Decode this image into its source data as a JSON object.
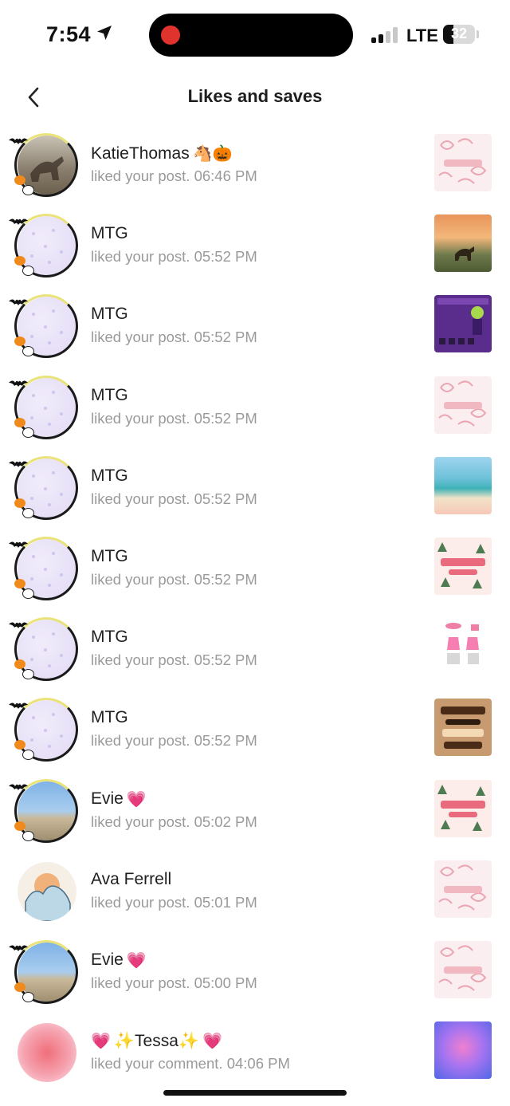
{
  "status_bar": {
    "time": "7:54",
    "network": "LTE",
    "battery": "32",
    "battery_level": 0.32
  },
  "header": {
    "title": "Likes and saves"
  },
  "icons": {
    "back": "chevron-left-icon",
    "location": "location-arrow-icon",
    "signal": "cellular-signal-icon"
  },
  "notifications": [
    {
      "name": "KatieThomas",
      "emoji": "🐴🎃",
      "action": "liked your post.",
      "time": "06:46 PM",
      "avatar": "photo-horse",
      "thumb": "bows"
    },
    {
      "name": "MTG",
      "emoji": "",
      "action": "liked your post.",
      "time": "05:52 PM",
      "avatar": "lavender",
      "thumb": "sunset-horse"
    },
    {
      "name": "MTG",
      "emoji": "",
      "action": "liked your post.",
      "time": "05:52 PM",
      "avatar": "lavender",
      "thumb": "jovial-joker"
    },
    {
      "name": "MTG",
      "emoji": "",
      "action": "liked your post.",
      "time": "05:52 PM",
      "avatar": "lavender",
      "thumb": "bows"
    },
    {
      "name": "MTG",
      "emoji": "",
      "action": "liked your post.",
      "time": "05:52 PM",
      "avatar": "lavender",
      "thumb": "beach"
    },
    {
      "name": "MTG",
      "emoji": "",
      "action": "liked your post.",
      "time": "05:52 PM",
      "avatar": "lavender",
      "thumb": "christmas"
    },
    {
      "name": "MTG",
      "emoji": "",
      "action": "liked your post.",
      "time": "05:52 PM",
      "avatar": "lavender",
      "thumb": "pink-outfit"
    },
    {
      "name": "MTG",
      "emoji": "",
      "action": "liked your post.",
      "time": "05:52 PM",
      "avatar": "lavender",
      "thumb": "fall-jesus"
    },
    {
      "name": "Evie",
      "emoji": "💗",
      "action": "liked your post.",
      "time": "05:02 PM",
      "avatar": "sky-beach",
      "thumb": "christmas"
    },
    {
      "name": "Ava Ferrell",
      "emoji": "",
      "action": "liked your post.",
      "time": "05:01 PM",
      "avatar": "wave",
      "thumb": "bows"
    },
    {
      "name": "Evie",
      "emoji": "💗",
      "action": "liked your post.",
      "time": "05:00 PM",
      "avatar": "sky-beach",
      "thumb": "bows"
    },
    {
      "name": "✨Tessa✨",
      "emoji": "💗",
      "emoji_before": "💗",
      "action": "liked your comment.",
      "time": "04:06 PM",
      "avatar": "pink-glow",
      "thumb": "purple-glow"
    }
  ]
}
